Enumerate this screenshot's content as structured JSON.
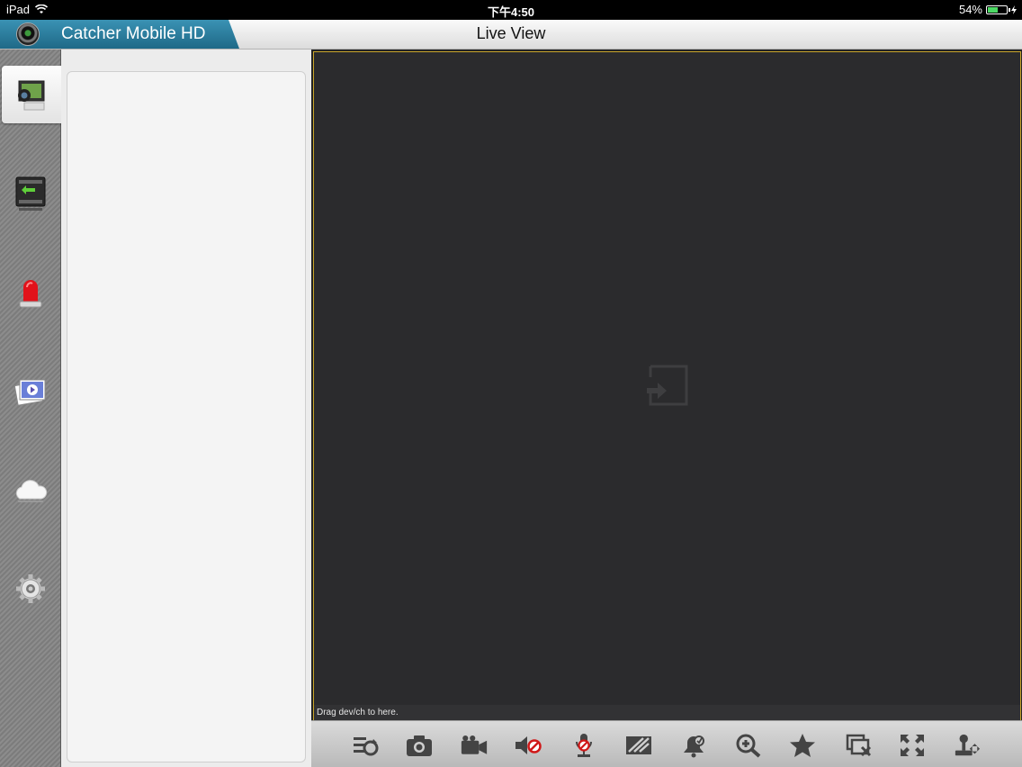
{
  "status_bar": {
    "device": "iPad",
    "time": "下午4:50",
    "battery": "54%",
    "battery_level": 0.54
  },
  "header": {
    "app_title": "Catcher Mobile HD",
    "page_title": "Live View"
  },
  "nav": {
    "items": [
      {
        "name": "live-view",
        "icon": "monitor-icon",
        "active": true
      },
      {
        "name": "playback",
        "icon": "film-playback-icon",
        "active": false
      },
      {
        "name": "alarm",
        "icon": "alarm-siren-icon",
        "active": false
      },
      {
        "name": "photos",
        "icon": "photo-video-icon",
        "active": false
      },
      {
        "name": "cloud",
        "icon": "cloud-icon",
        "active": false
      },
      {
        "name": "settings",
        "icon": "gear-icon",
        "active": false
      }
    ]
  },
  "video": {
    "hint": "Drag dev/ch to here.",
    "drop_icon": "drop-target-icon",
    "frame_color": "#c9a52a"
  },
  "toolbar": {
    "buttons": [
      {
        "name": "stream-switch",
        "icon": "stream-switch-icon"
      },
      {
        "name": "snapshot",
        "icon": "camera-icon"
      },
      {
        "name": "record",
        "icon": "video-camera-icon"
      },
      {
        "name": "audio",
        "icon": "speaker-mute-icon"
      },
      {
        "name": "talk",
        "icon": "microphone-off-icon"
      },
      {
        "name": "quality",
        "icon": "quality-icon"
      },
      {
        "name": "alarm-out",
        "icon": "bell-icon"
      },
      {
        "name": "zoom",
        "icon": "zoom-in-icon"
      },
      {
        "name": "favorite",
        "icon": "star-icon"
      },
      {
        "name": "close-window",
        "icon": "close-window-icon"
      },
      {
        "name": "fullscreen",
        "icon": "fullscreen-icon"
      },
      {
        "name": "ptz",
        "icon": "ptz-joystick-icon"
      }
    ]
  }
}
